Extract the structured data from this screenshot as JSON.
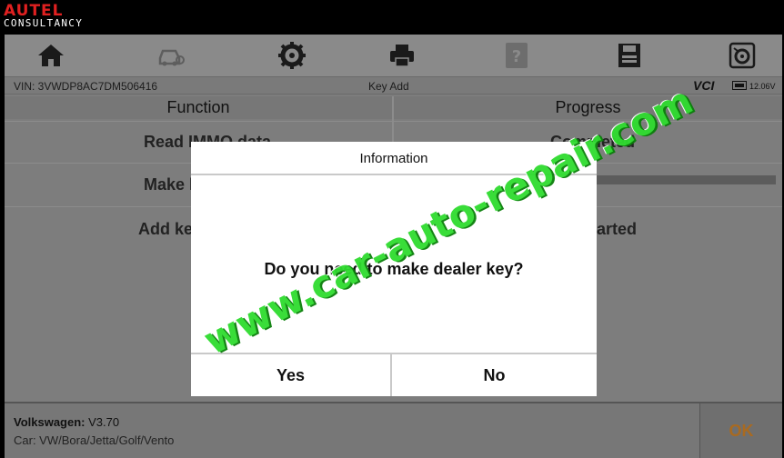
{
  "brand": {
    "logo": "AUTEL",
    "subtitle": "CONSULTANCY"
  },
  "toolbar": {
    "icons": [
      "home-icon",
      "car-icon",
      "gear-icon",
      "printer-icon",
      "help-icon",
      "save-icon",
      "datalogging-icon"
    ]
  },
  "infobar": {
    "vin": "VIN: 3VWDP8AC7DM506416",
    "title": "Key Add",
    "vci": "VCI",
    "battery": "12.06V"
  },
  "columns": {
    "function": "Function",
    "progress": "Progress"
  },
  "rows": [
    {
      "function": "Read IMMO data",
      "progress": "Completed"
    },
    {
      "function": "Make key",
      "progress": ""
    },
    {
      "function": "Add key",
      "progress": "Not started"
    }
  ],
  "footer": {
    "make_label": "Volkswagen:",
    "version": "V3.70",
    "car": "Car: VW/Bora/Jetta/Golf/Vento",
    "ok_label": "OK"
  },
  "dialog": {
    "title": "Information",
    "message": "Do you need to make dealer key?",
    "yes_label": "Yes",
    "no_label": "No"
  },
  "watermark": "www.car-auto-repair.com",
  "colors": {
    "brand_red": "#e02020",
    "watermark_green": "#2fdc2f",
    "ok_orange": "#a96a20"
  }
}
